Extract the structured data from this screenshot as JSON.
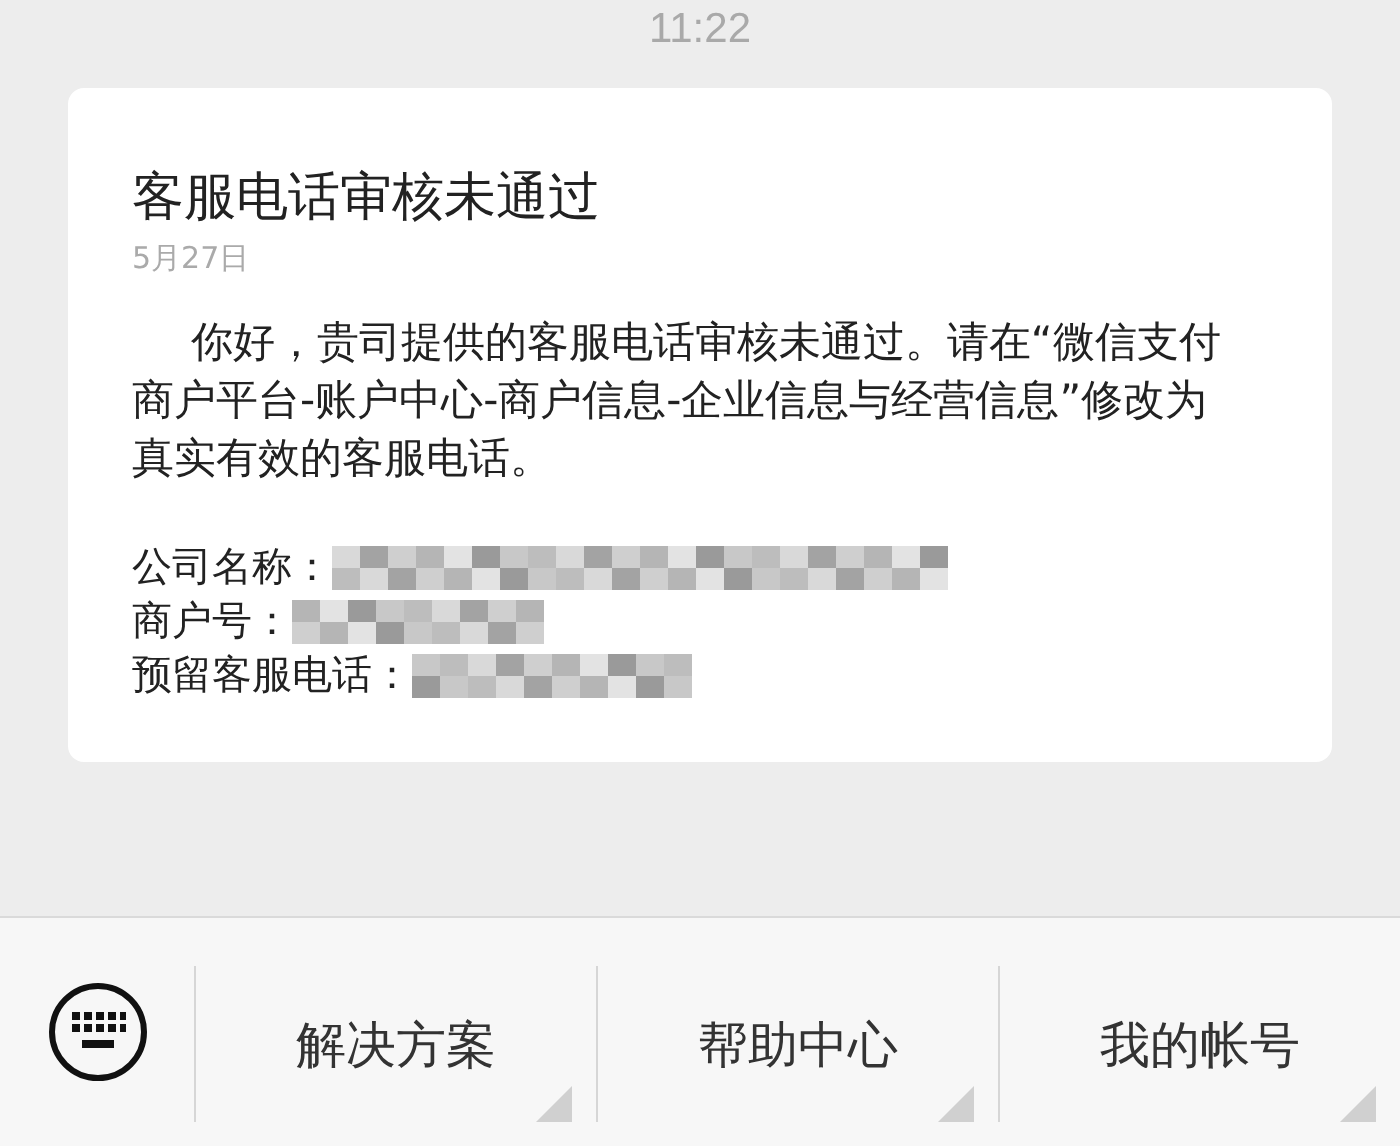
{
  "time": "11:22",
  "message": {
    "title": "客服电话审核未通过",
    "date": "5月27日",
    "body": "你好，贵司提供的客服电话审核未通过。请在“微信支付商户平台-账户中心-商户信息-企业信息与经营信息”修改为真实有效的客服电话。",
    "fields": [
      {
        "label": "公司名称：",
        "value_hidden": true
      },
      {
        "label": "商户号：",
        "value_hidden": true
      },
      {
        "label": "预留客服电话：",
        "value_hidden": true
      }
    ]
  },
  "menu": {
    "items": [
      {
        "label": "解决方案",
        "has_submenu": true
      },
      {
        "label": "帮助中心",
        "has_submenu": true
      },
      {
        "label": "我的帐号",
        "has_submenu": true
      }
    ]
  }
}
